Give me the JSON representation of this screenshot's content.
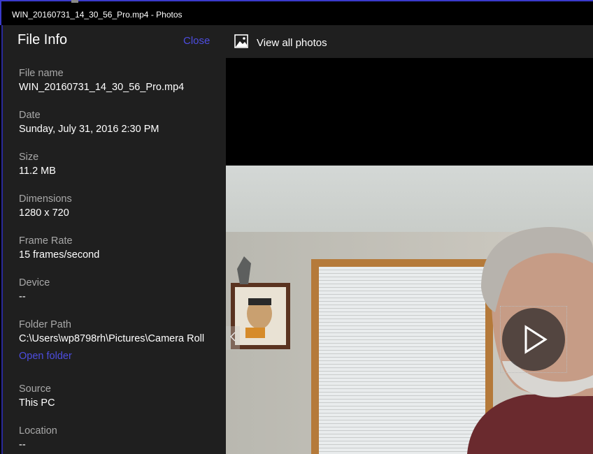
{
  "window": {
    "title": "WIN_20160731_14_30_56_Pro.mp4 - Photos"
  },
  "info_pane": {
    "title": "File Info",
    "close_label": "Close",
    "fields": [
      {
        "label": "File name",
        "value": "WIN_20160731_14_30_56_Pro.mp4"
      },
      {
        "label": "Date",
        "value": "Sunday, July 31, 2016 2:30 PM"
      },
      {
        "label": "Size",
        "value": "11.2 MB"
      },
      {
        "label": "Dimensions",
        "value": "1280 x 720"
      },
      {
        "label": "Frame Rate",
        "value": "15 frames/second"
      },
      {
        "label": "Device",
        "value": "--"
      },
      {
        "label": "Folder Path",
        "value": "C:\\Users\\wp8798rh\\Pictures\\Camera Roll"
      },
      {
        "label": "Source",
        "value": "This PC"
      },
      {
        "label": "Location",
        "value": "--"
      }
    ],
    "open_folder_label": "Open folder"
  },
  "toolbar": {
    "view_all_label": "View all photos",
    "view_all_icon": "photo-gallery-icon"
  },
  "viewer": {
    "prev_icon": "chevron-left-icon",
    "play_icon": "play-icon"
  },
  "colors": {
    "pane_bg": "#1f1f1f",
    "accent_link": "#4d4de0",
    "label_gray": "#a8a8a8"
  }
}
